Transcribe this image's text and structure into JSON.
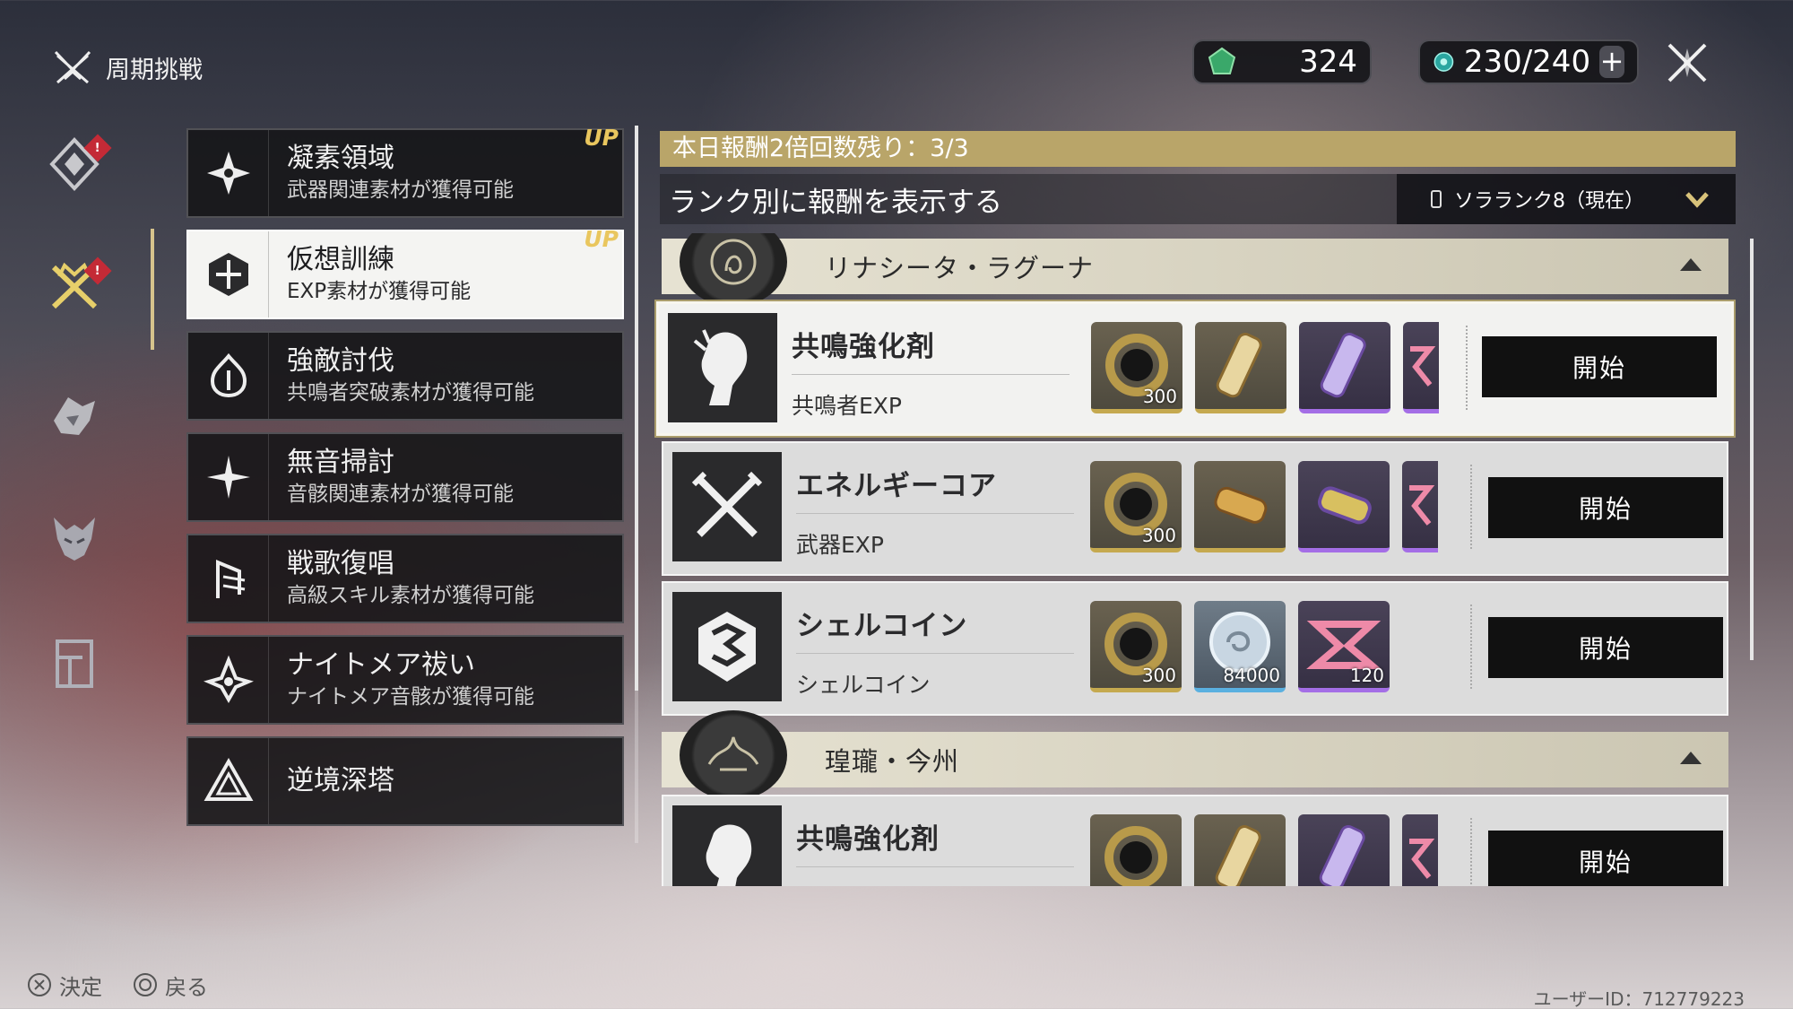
{
  "header": {
    "title": "周期挑戦",
    "currency1": {
      "icon": "green-crystal-icon",
      "value": "324"
    },
    "currency2": {
      "icon": "waveplate-icon",
      "value": "230/240",
      "plus_label": "+"
    },
    "close_icon": "close-icon"
  },
  "rail": [
    {
      "icon": "diamond-emblem-icon",
      "badge": "!"
    },
    {
      "icon": "crossed-swords-crown-icon",
      "badge": "!"
    },
    {
      "icon": "shield-creature-icon"
    },
    {
      "icon": "demon-mask-icon"
    },
    {
      "icon": "tower-gate-icon"
    }
  ],
  "menu": [
    {
      "name": "凝素領域",
      "sub": "武器関連素材が獲得可能",
      "up": "UP",
      "icon": "crystal-cluster-icon"
    },
    {
      "name": "仮想訓練",
      "sub": "EXP素材が獲得可能",
      "up": "UP",
      "icon": "hex-gem-icon"
    },
    {
      "name": "強敵討伐",
      "sub": "共鳴者突破素材が獲得可能",
      "icon": "flame-crest-icon"
    },
    {
      "name": "無音掃討",
      "sub": "音骸関連素材が獲得可能",
      "icon": "sparkle-star-icon"
    },
    {
      "name": "戦歌復唱",
      "sub": "高級スキル素材が獲得可能",
      "icon": "feather-scroll-icon"
    },
    {
      "name": "ナイトメア祓い",
      "sub": "ナイトメア音骸が獲得可能",
      "icon": "nightmare-flame-icon"
    },
    {
      "name": "逆境深塔",
      "sub": "",
      "icon": "triangle-tower-icon"
    }
  ],
  "main": {
    "banner": "本日報酬2倍回数残り：3/3",
    "rank_label": "ランク別に報酬を表示する",
    "rank_select": "ソラランク8（現在）",
    "groups": [
      {
        "name": "リナシータ・ラグーナ",
        "emblem": "rinascita-emblem-icon",
        "rows": [
          {
            "name": "共鳴強化剤",
            "sub": "共鳴者EXP",
            "icon": "resonator-portrait-icon",
            "start": "開始",
            "items": [
              {
                "icon": "shell-ring-icon",
                "qty": "300",
                "rarity": "gold"
              },
              {
                "icon": "potion-vial-gold-icon",
                "qty": "",
                "rarity": "gold"
              },
              {
                "icon": "potion-vial-purple-icon",
                "qty": "",
                "rarity": "purp"
              }
            ]
          },
          {
            "name": "エネルギーコア",
            "sub": "武器EXP",
            "icon": "crossed-swords-icon",
            "start": "開始",
            "items": [
              {
                "icon": "shell-ring-icon",
                "qty": "300",
                "rarity": "gold"
              },
              {
                "icon": "energy-core-gold-icon",
                "qty": "",
                "rarity": "gold"
              },
              {
                "icon": "energy-core-purple-icon",
                "qty": "",
                "rarity": "purp"
              }
            ]
          },
          {
            "name": "シェルコイン",
            "sub": "シェルコイン",
            "icon": "shell-credit-icon",
            "start": "開始",
            "items": [
              {
                "icon": "shell-ring-icon",
                "qty": "300",
                "rarity": "gold"
              },
              {
                "icon": "shell-coin-icon",
                "qty": "84000",
                "rarity": "blue"
              },
              {
                "icon": "pink-emblem-icon",
                "qty": "120",
                "rarity": "purp"
              }
            ]
          }
        ]
      },
      {
        "name": "瑝瓏・今州",
        "emblem": "jinzhou-emblem-icon",
        "rows": [
          {
            "name": "共鳴強化剤",
            "sub": "",
            "icon": "resonator-portrait-icon",
            "start": "開始",
            "items": [
              {
                "icon": "shell-ring-icon",
                "qty": "",
                "rarity": "gold"
              },
              {
                "icon": "potion-vial-gold-icon",
                "qty": "",
                "rarity": "gold"
              },
              {
                "icon": "potion-vial-purple-icon",
                "qty": "",
                "rarity": "purp"
              }
            ]
          }
        ]
      }
    ]
  },
  "footer": {
    "confirm": "決定",
    "back": "戻る",
    "uid": "ユーザーID：712779223"
  }
}
